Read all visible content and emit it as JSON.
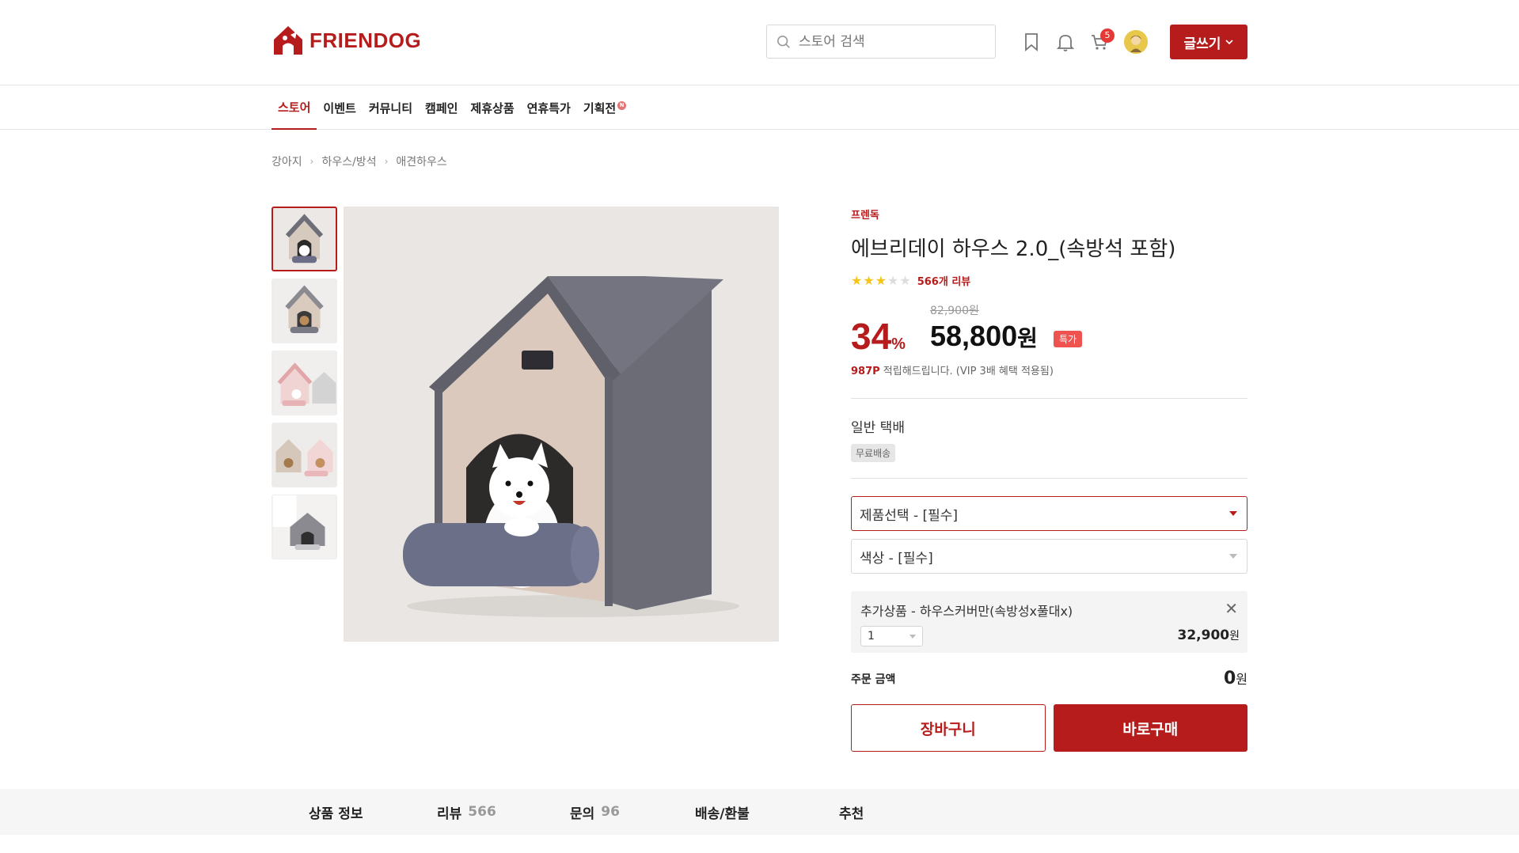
{
  "brand_logo": {
    "name": "FRIENDOG",
    "color": "#b71c1c"
  },
  "header": {
    "search_placeholder": "스토어 검색",
    "cart_count": "5",
    "write_label": "글쓰기",
    "icons": [
      "bookmark-icon",
      "bell-icon",
      "cart-icon"
    ]
  },
  "nav": {
    "items": [
      {
        "label": "스토어",
        "active": true
      },
      {
        "label": "이벤트"
      },
      {
        "label": "커뮤니티"
      },
      {
        "label": "캠페인"
      },
      {
        "label": "제휴상품"
      },
      {
        "label": "연휴특가"
      },
      {
        "label": "기획전",
        "new_badge": "N"
      }
    ]
  },
  "breadcrumb": [
    "강아지",
    "하우스/방석",
    "애견하우스"
  ],
  "product": {
    "brand": "프렌독",
    "title": "에브리데이 하우스 2.0_(속방석 포함)",
    "rating": 3,
    "rating_max": 5,
    "review_count_label": "566개 리뷰",
    "discount": "34",
    "discount_unit": "%",
    "original_price": "82,900원",
    "price": "58,800",
    "price_unit": "원",
    "deal_badge": "특가",
    "points": "987P",
    "points_text": " 적립해드립니다. (VIP 3배 혜택 적용됨)",
    "shipping_title": "일반 택배",
    "shipping_badge": "무료배송",
    "select_product": "제품선택 - [필수]",
    "select_color": "색상 - [필수]",
    "addon": {
      "name": "추가상품 - 하우스커버만(속방성x풀대x)",
      "qty": "1",
      "price": "32,900",
      "price_unit": "원"
    },
    "total_label": "주문 금액",
    "total_value": "0",
    "total_unit": "원",
    "cart_button": "장바구니",
    "buy_button": "바로구매"
  },
  "tabs": [
    {
      "label": "상품 정보",
      "count": ""
    },
    {
      "label": "리뷰",
      "count": "566"
    },
    {
      "label": "문의",
      "count": "96"
    },
    {
      "label": "배송/환불",
      "count": ""
    },
    {
      "label": "추천",
      "count": ""
    }
  ]
}
